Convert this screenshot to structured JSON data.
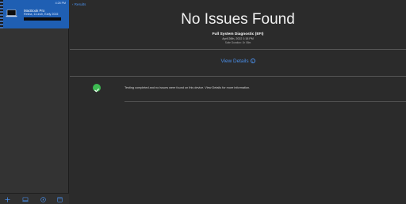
{
  "sidebar": {
    "device": {
      "time": "4:28 PM",
      "name": "MacBook Pro",
      "model": "Retina, 13-inch, Early 2015"
    },
    "toolbar": {
      "items": [
        "add-icon",
        "device-icon",
        "compass-icon",
        "archive-icon"
      ]
    }
  },
  "header": {
    "back_label": "Results"
  },
  "summary": {
    "title": "No Issues Found",
    "test_name": "Full System Diagnostic (EFI)",
    "date": "April 26th, 2022 1:18 PM",
    "duration": "Suite Duration: 1h 08m"
  },
  "details": {
    "label": "View Details",
    "info_symbol": "i"
  },
  "results": [
    {
      "status": "pass",
      "message": "Testing completed and no issues were found on this device. View Details for more information."
    }
  ],
  "colors": {
    "accent": "#4a8fea",
    "selected": "#1f5fb3",
    "success": "#3dbb52"
  }
}
